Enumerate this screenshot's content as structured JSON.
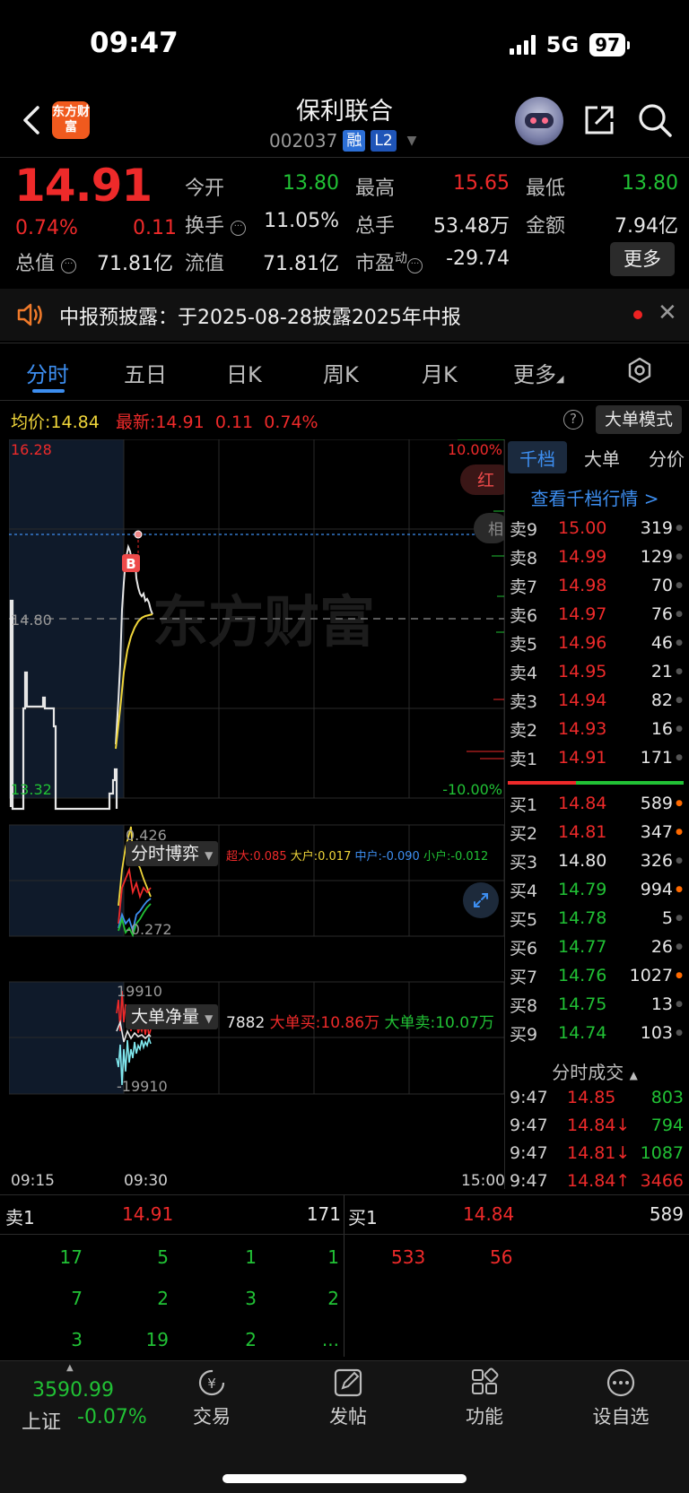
{
  "status": {
    "time": "09:47",
    "network": "5G",
    "battery": "97"
  },
  "header": {
    "logo_text": "东方财富",
    "name": "保利联合",
    "code": "002037",
    "tag1": "融",
    "tag2": "L2"
  },
  "quote": {
    "price": "14.91",
    "change_pct": "0.74%",
    "change": "0.11",
    "mcap_label": "总值",
    "mcap": "71.81亿",
    "open_label": "今开",
    "open": "13.80",
    "high_label": "最高",
    "high": "15.65",
    "low_label": "最低",
    "low": "13.80",
    "turnover_label": "换手",
    "turnover": "11.05%",
    "vol_label": "总手",
    "vol": "53.48万",
    "amount_label": "金额",
    "amount": "7.94亿",
    "float_label": "流值",
    "float": "71.81亿",
    "pe_label": "市盈",
    "pe_sup": "动",
    "pe": "-29.74",
    "more": "更多"
  },
  "notice": {
    "text": "中报预披露：于2025-08-28披露2025年中报"
  },
  "tabs": [
    "分时",
    "五日",
    "日K",
    "周K",
    "月K",
    "更多"
  ],
  "chart_info": {
    "avg_label": "均价:",
    "avg": "14.84",
    "latest_label": "最新:",
    "latest": "14.91",
    "latest_chg": "0.11",
    "latest_pct": "0.74%",
    "help": "?",
    "big_mode": "大单模式"
  },
  "main_chart": {
    "y_top": "16.28",
    "y_mid": "14.80",
    "y_bottom": "13.32",
    "pct_top": "10.00%",
    "pct_bottom": "-10.00%",
    "watermark": "东方财富",
    "b_marker": "B",
    "side_badge1": "红",
    "side_badge2": "相"
  },
  "boyi": {
    "label": "分时博弈",
    "y_top": "0.426",
    "y_bottom": "-0.272",
    "legend": [
      {
        "text": "超大:0.085",
        "color": "#ee2a2a"
      },
      {
        "text": "大户:0.017",
        "color": "#f0d63a"
      },
      {
        "text": "中户:-0.090",
        "color": "#3d8ef0"
      },
      {
        "text": "小户:-0.012",
        "color": "#21c135"
      }
    ]
  },
  "netvol": {
    "label": "大单净量",
    "value": "7882",
    "buy": "大单买:10.86万",
    "sell": "大单卖:10.07万",
    "y_top": "19910",
    "y_bottom": "-19910"
  },
  "time_axis": [
    "09:15",
    "09:30",
    "15:00"
  ],
  "orderbook": {
    "tabs": [
      "千档",
      "大单",
      "分价"
    ],
    "link": "查看千档行情 >",
    "asks": [
      {
        "label": "卖9",
        "price": "15.00",
        "vol": "319",
        "dot": "#555"
      },
      {
        "label": "卖8",
        "price": "14.99",
        "vol": "129",
        "dot": "#555"
      },
      {
        "label": "卖7",
        "price": "14.98",
        "vol": "70",
        "dot": "#555"
      },
      {
        "label": "卖6",
        "price": "14.97",
        "vol": "76",
        "dot": "#555"
      },
      {
        "label": "卖5",
        "price": "14.96",
        "vol": "46",
        "dot": "#555"
      },
      {
        "label": "卖4",
        "price": "14.95",
        "vol": "21",
        "dot": "#555"
      },
      {
        "label": "卖3",
        "price": "14.94",
        "vol": "82",
        "dot": "#555"
      },
      {
        "label": "卖2",
        "price": "14.93",
        "vol": "16",
        "dot": "#555"
      },
      {
        "label": "卖1",
        "price": "14.91",
        "vol": "171",
        "dot": "#555"
      }
    ],
    "bids": [
      {
        "label": "买1",
        "price": "14.84",
        "vol": "589",
        "dot": "#ff6a00",
        "color": "#ee2a2a"
      },
      {
        "label": "买2",
        "price": "14.81",
        "vol": "347",
        "dot": "#ff6a00",
        "color": "#ee2a2a"
      },
      {
        "label": "买3",
        "price": "14.80",
        "vol": "326",
        "dot": "#555",
        "color": "#e6e6e6"
      },
      {
        "label": "买4",
        "price": "14.79",
        "vol": "994",
        "dot": "#ff6a00",
        "color": "#21c135"
      },
      {
        "label": "买5",
        "price": "14.78",
        "vol": "5",
        "dot": "#555",
        "color": "#21c135"
      },
      {
        "label": "买6",
        "price": "14.77",
        "vol": "26",
        "dot": "#555",
        "color": "#21c135"
      },
      {
        "label": "买7",
        "price": "14.76",
        "vol": "1027",
        "dot": "#ff6a00",
        "color": "#21c135"
      },
      {
        "label": "买8",
        "price": "14.75",
        "vol": "13",
        "dot": "#555",
        "color": "#21c135"
      },
      {
        "label": "买9",
        "price": "14.74",
        "vol": "103",
        "dot": "#555",
        "color": "#21c135"
      }
    ],
    "ticks_title": "分时成交",
    "ticks": [
      {
        "time": "9:47",
        "price": "14.85",
        "vol": "803",
        "vcolor": "#21c135"
      },
      {
        "time": "9:47",
        "price": "14.84↓",
        "vol": "794",
        "vcolor": "#21c135"
      },
      {
        "time": "9:47",
        "price": "14.81↓",
        "vol": "1087",
        "vcolor": "#21c135"
      },
      {
        "time": "9:47",
        "price": "14.84↑",
        "vol": "3466",
        "vcolor": "#ee2a2a"
      }
    ]
  },
  "level_table": {
    "ask_label": "卖1",
    "ask_price": "14.91",
    "ask_vol": "171",
    "bid_label": "买1",
    "bid_price": "14.84",
    "bid_vol": "589",
    "ask_queue": [
      [
        "17",
        "5",
        "1",
        "1"
      ],
      [
        "7",
        "2",
        "3",
        "2"
      ],
      [
        "3",
        "19",
        "2",
        "..."
      ]
    ],
    "bid_queue": [
      "533",
      "56"
    ]
  },
  "bottom_nav": {
    "index_value": "3590.99",
    "index_name": "上证",
    "index_pct": "-0.07%",
    "items": [
      "交易",
      "发帖",
      "功能",
      "设自选"
    ]
  }
}
